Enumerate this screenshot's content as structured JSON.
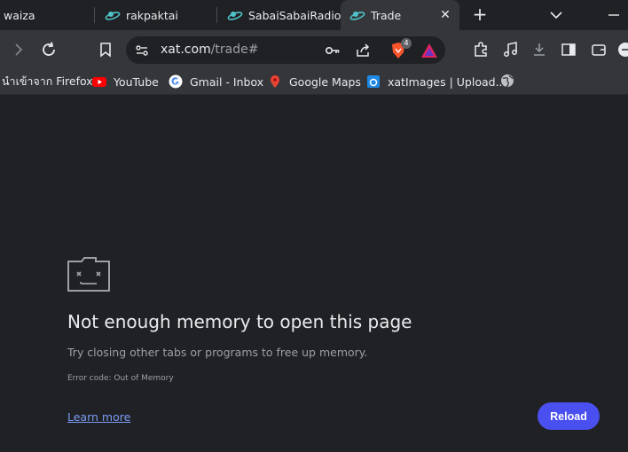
{
  "tabs": [
    {
      "label": "waiza"
    },
    {
      "label": "rakpaktai"
    },
    {
      "label": "SabaiSabaiRadio"
    },
    {
      "label": "Trade",
      "active": true
    }
  ],
  "address": {
    "host": "xat.com",
    "path": "/trade#"
  },
  "extensions": {
    "brave_badge": "4"
  },
  "bookmarks": [
    {
      "label": "นำเข้าจาก Firefox"
    },
    {
      "label": "YouTube",
      "icon": "youtube-icon"
    },
    {
      "label": "Gmail - Inbox",
      "icon": "google-icon"
    },
    {
      "label": "Google Maps",
      "icon": "maps-icon"
    },
    {
      "label": "xatImages | Upload...",
      "icon": "xat-icon"
    }
  ],
  "error": {
    "title": "Not enough memory to open this page",
    "message": "Try closing other tabs or programs to free up memory.",
    "code": "Error code: Out of Memory",
    "learn_more": "Learn more",
    "reload": "Reload"
  },
  "colors": {
    "accent": "#4a50f0",
    "link": "#7c9cf5",
    "background": "#202124",
    "toolbar": "#35363a"
  }
}
